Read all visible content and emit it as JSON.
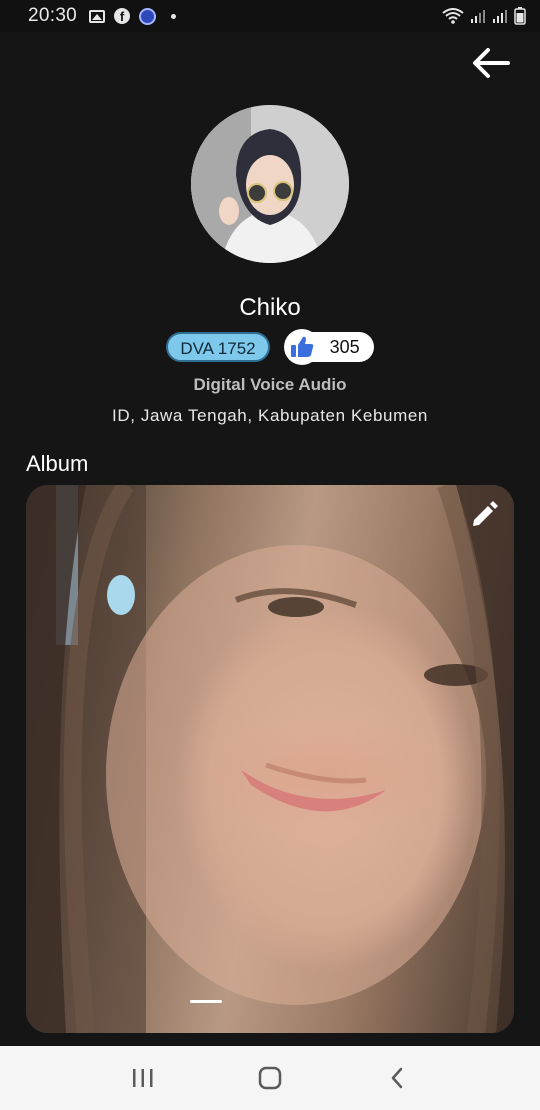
{
  "status_bar": {
    "time": "20:30",
    "icons": [
      "gallery-icon",
      "facebook-icon",
      "app-icon",
      "dot-icon",
      "wifi-icon",
      "signal-icon",
      "signal-icon",
      "battery-icon"
    ]
  },
  "header": {
    "back_icon": "arrow-left-icon"
  },
  "profile": {
    "name": "Chiko",
    "id_badge": "DVA 1752",
    "likes": "305",
    "like_icon": "thumbs-up-icon",
    "company": "Digital Voice Audio",
    "location": "ID, Jawa Tengah, Kabupaten Kebumen"
  },
  "album": {
    "title": "Album",
    "edit_icon": "pencil-icon",
    "current_page": 1
  },
  "nav": {
    "icons": [
      "recent-apps-icon",
      "home-icon",
      "back-icon"
    ]
  },
  "colors": {
    "background": "#151515",
    "id_badge_bg": "#7ec8ec",
    "like_blue": "#3b6fe0",
    "nav_bar": "#f5f5f5"
  }
}
